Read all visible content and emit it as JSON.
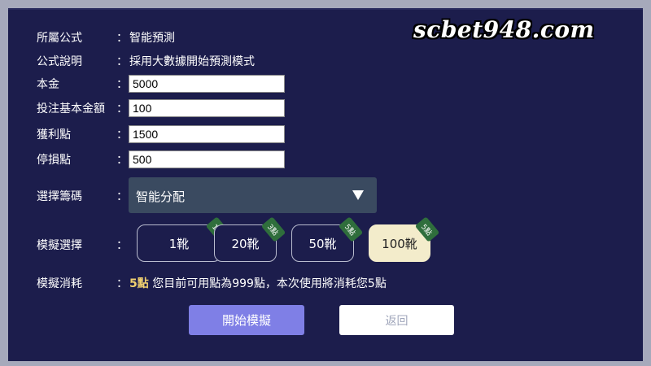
{
  "watermark": "scbet948.com",
  "form": {
    "formula_label": "所屬公式",
    "formula_value": "智能預測",
    "desc_label": "公式說明",
    "desc_value": "採用大數據開始預測模式",
    "principal_label": "本金",
    "principal_value": "5000",
    "base_bet_label": "投注基本金額",
    "base_bet_value": "100",
    "take_profit_label": "獲利點",
    "take_profit_value": "1500",
    "stop_loss_label": "停損點",
    "stop_loss_value": "500",
    "chips_label": "選擇籌碼",
    "chips_value": "智能分配",
    "colon": "："
  },
  "simulation": {
    "label": "模擬選擇",
    "options": [
      {
        "label": "1靴",
        "tag": "1點"
      },
      {
        "label": "20靴",
        "tag": "3點"
      },
      {
        "label": "50靴",
        "tag": "5點"
      },
      {
        "label": "100靴",
        "tag": "5點",
        "selected": true
      }
    ]
  },
  "consumption": {
    "label": "模擬消耗",
    "points": "5點",
    "text": " 您目前可用點為999點，本次使用將消耗您5點"
  },
  "buttons": {
    "start": "開始模擬",
    "back": "返回"
  },
  "colors": {
    "panel": "#1c1d4c",
    "primary": "#7f7fe6",
    "selected_option": "#f3eccb",
    "tag": "#2f6e3c",
    "points_highlight": "#f0d070"
  },
  "icons": {
    "dropdown": "triangle-down-icon"
  }
}
